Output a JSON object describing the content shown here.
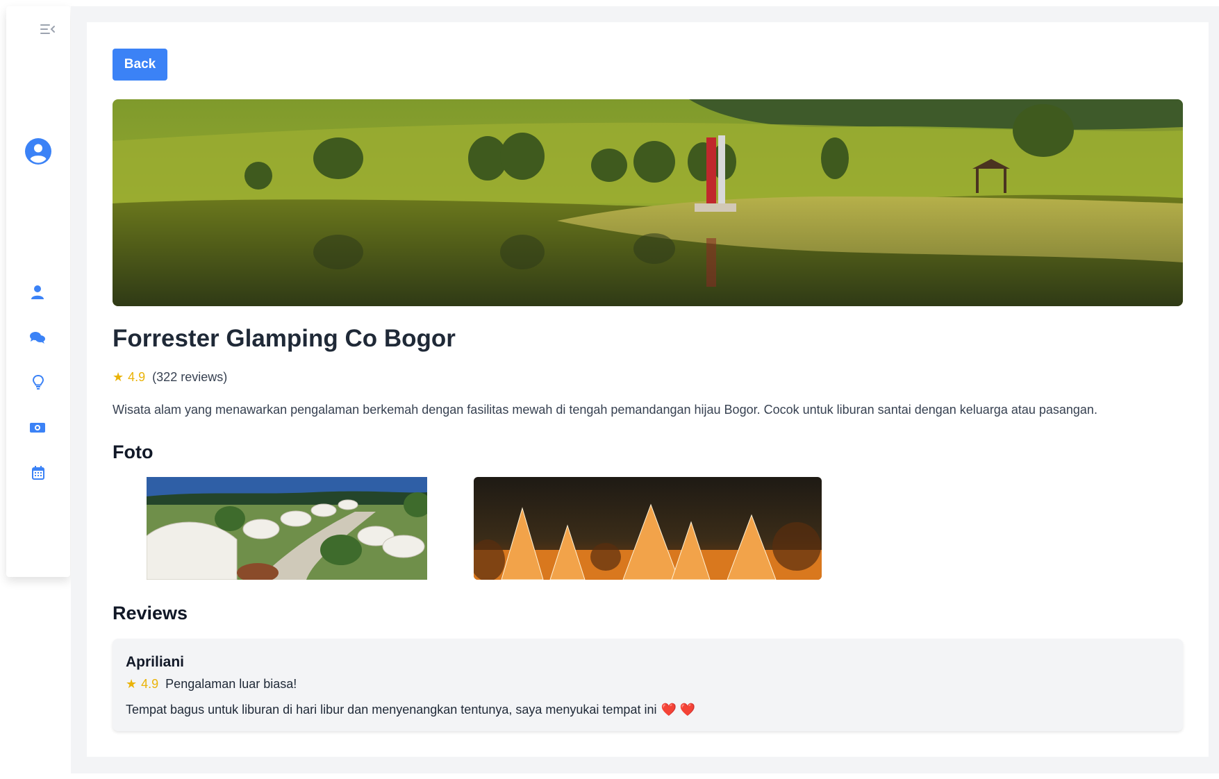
{
  "sidebar": {
    "items": [
      {
        "icon": "collapse-menu-icon"
      },
      {
        "icon": "user-circle-icon"
      },
      {
        "icon": "user-icon"
      },
      {
        "icon": "comments-icon"
      },
      {
        "icon": "lightbulb-icon"
      },
      {
        "icon": "money-icon"
      },
      {
        "icon": "calendar-icon"
      }
    ],
    "accent": "#3b82f6"
  },
  "toolbar": {
    "back_label": "Back"
  },
  "place": {
    "name": "Forrester Glamping Co Bogor",
    "star": "★",
    "rating": "4.9",
    "reviews_count": "(322 reviews)",
    "description": "Wisata alam yang menawarkan pengalaman berkemah dengan fasilitas mewah di tengah pemandangan hijau Bogor. Cocok untuk liburan santai dengan keluarga atau pasangan."
  },
  "photos_section": {
    "heading": "Foto"
  },
  "reviews_section": {
    "heading": "Reviews",
    "items": [
      {
        "author": "Apriliani",
        "star": "★",
        "rating": "4.9",
        "title": "Pengalaman luar biasa!",
        "text": "Tempat bagus untuk liburan di hari libur dan menyenangkan tentunya, saya menyukai tempat ini",
        "emoji": "❤️ ❤️"
      }
    ]
  }
}
